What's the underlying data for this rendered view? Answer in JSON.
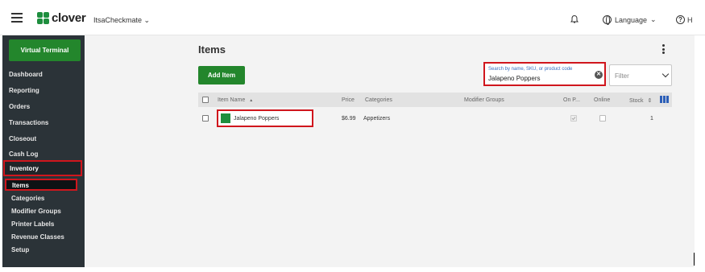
{
  "topbar": {
    "logo_text": "clover",
    "merchant_name": "ItsaCheckmate",
    "merchant_chevron": "⌄",
    "language_label": "Language",
    "language_chevron": "⌄",
    "help_label": "H",
    "help_glyph": "?"
  },
  "sidebar": {
    "virtual_terminal": "Virtual Terminal",
    "items": [
      {
        "label": "Dashboard"
      },
      {
        "label": "Reporting"
      },
      {
        "label": "Orders"
      },
      {
        "label": "Transactions"
      },
      {
        "label": "Closeout"
      },
      {
        "label": "Cash Log"
      },
      {
        "label": "Inventory"
      }
    ],
    "subitems": [
      {
        "label": "Items"
      },
      {
        "label": "Categories"
      },
      {
        "label": "Modifier Groups"
      },
      {
        "label": "Printer Labels"
      },
      {
        "label": "Revenue Classes"
      },
      {
        "label": "Setup"
      }
    ]
  },
  "main": {
    "title": "Items",
    "add_item": "Add Item",
    "search": {
      "placeholder": "Search by name, SKU, or product code",
      "value": "Jalapeno Poppers",
      "clear_glyph": "✕"
    },
    "filter_label": "Filter",
    "table": {
      "headers": {
        "item_name": "Item Name",
        "sort_glyph": "▲",
        "price": "Price",
        "categories": "Categories",
        "modifier_groups": "Modifier Groups",
        "on_pos": "On P...",
        "online": "Online",
        "stock": "Stock",
        "stock_sort": "⇕"
      },
      "rows": [
        {
          "name": "Jalapeno Poppers",
          "price": "$6.99",
          "categories": "Appetizers",
          "modifier_groups": "",
          "stock": "1",
          "color": "#1e8e3e"
        }
      ]
    }
  },
  "colors": {
    "accent_green": "#23862c",
    "sidebar_bg": "#2b3338",
    "highlight_red": "#d0161d"
  }
}
